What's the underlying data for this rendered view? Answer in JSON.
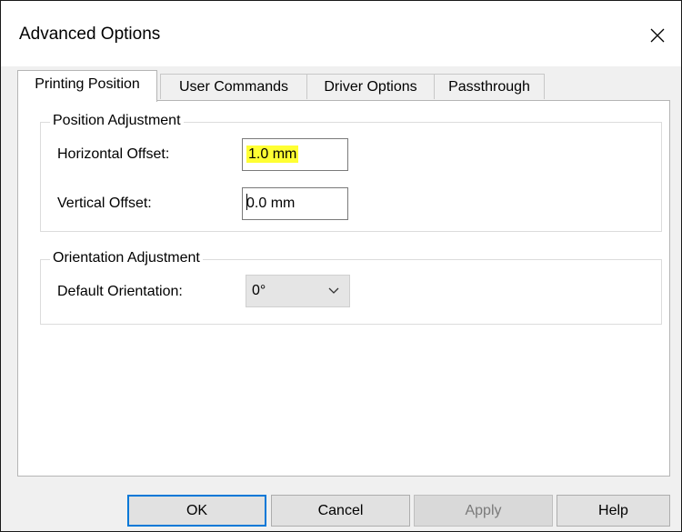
{
  "window": {
    "title": "Advanced Options",
    "close_icon": "close-icon"
  },
  "tabs": [
    {
      "label": "Printing Position",
      "active": true
    },
    {
      "label": "User Commands",
      "active": false
    },
    {
      "label": "Driver Options",
      "active": false
    },
    {
      "label": "Passthrough",
      "active": false
    }
  ],
  "position_adjustment": {
    "title": "Position Adjustment",
    "horizontal_label": "Horizontal Offset:",
    "horizontal_value": "1.0 mm",
    "vertical_label": "Vertical Offset:",
    "vertical_value": "0.0 mm"
  },
  "orientation_adjustment": {
    "title": "Orientation Adjustment",
    "default_label": "Default Orientation:",
    "default_value": "0°"
  },
  "buttons": {
    "ok": "OK",
    "cancel": "Cancel",
    "apply": "Apply",
    "help": "Help"
  },
  "colors": {
    "highlight": "#ffff33",
    "focus_border": "#0078d7"
  }
}
